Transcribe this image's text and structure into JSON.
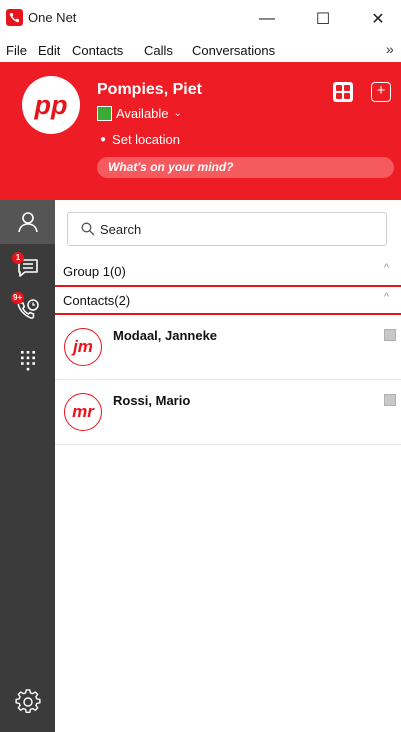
{
  "window": {
    "title": "One Net",
    "minimize": "—",
    "maximize": "☐",
    "close": "✕"
  },
  "menu": {
    "items": [
      "File",
      "Edit",
      "Contacts",
      "Calls",
      "Conversations"
    ],
    "overflow": "»"
  },
  "profile": {
    "initials": "pp",
    "name": "Pompies, Piet",
    "status": "Available",
    "status_color": "#3aa935",
    "location": "Set location",
    "mind_placeholder": "What's on your mind?",
    "add_symbol": "+"
  },
  "nav": {
    "conversations_badge": "1",
    "calls_badge": "9+"
  },
  "search": {
    "placeholder": "Search"
  },
  "groups": [
    {
      "label": "Group 1(0)",
      "caret": "^"
    },
    {
      "label": "Contacts(2)",
      "caret": "^"
    }
  ],
  "contacts": [
    {
      "initials": "jm",
      "name": "Modaal, Janneke"
    },
    {
      "initials": "mr",
      "name": "Rossi, Mario"
    }
  ],
  "colors": {
    "brand_red": "#ee1c25",
    "nav_dark": "#3b3b3b"
  }
}
